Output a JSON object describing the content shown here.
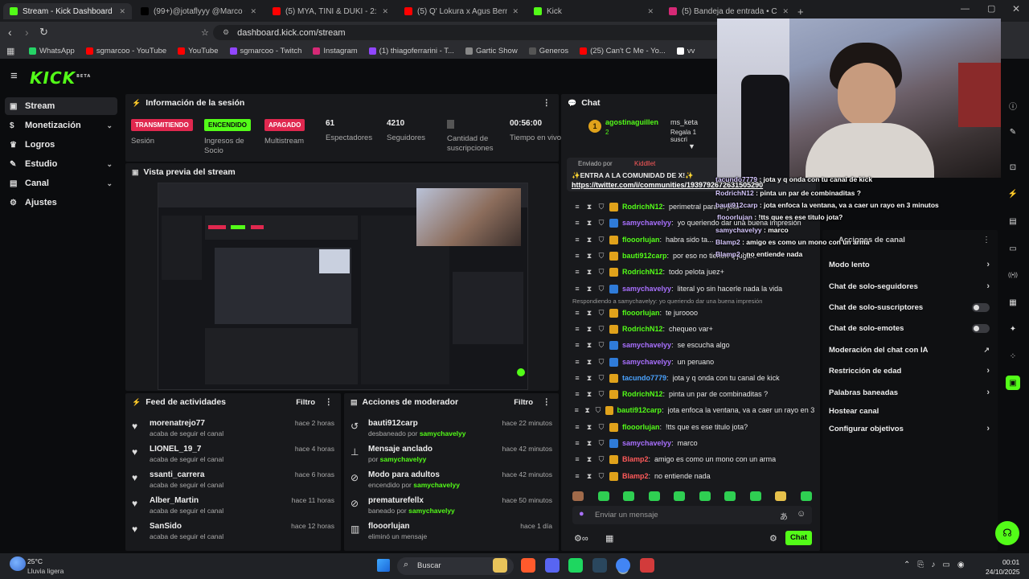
{
  "browser": {
    "tabs": [
      {
        "label": "Stream - Kick Dashboard",
        "color": "#53fc18"
      },
      {
        "label": "(99+)@jotaflyyy @Marco Guillén",
        "color": "#000000"
      },
      {
        "label": "(5) MYA, TINI & DUKI - 2:50 Remix (C",
        "color": "#ff0000"
      },
      {
        "label": "(5) Q' Lokura x Agus Bernasconi - CC",
        "color": "#ff0000"
      },
      {
        "label": "Kick",
        "color": "#53fc18"
      },
      {
        "label": "(5) Bandeja de entrada • Chats",
        "color": "#d62976"
      }
    ],
    "url": "dashboard.kick.com/stream",
    "bookmarks": [
      "WhatsApp",
      "sgmarcoo - YouTube",
      "YouTube",
      "sgmarcoo - Twitch",
      "Instagram",
      "(1) thiagoferrarini - T...",
      "Gartic Show",
      "Generos",
      "(25) Can't C Me - Yo...",
      "vv"
    ]
  },
  "kick": {
    "logo": "KICK",
    "beta": "BETA"
  },
  "sidebar": {
    "items": [
      {
        "label": "Stream",
        "icon": "video-icon"
      },
      {
        "label": "Monetización",
        "icon": "money-icon"
      },
      {
        "label": "Logros",
        "icon": "trophy-icon"
      },
      {
        "label": "Estudio",
        "icon": "studio-icon"
      },
      {
        "label": "Canal",
        "icon": "channel-icon"
      },
      {
        "label": "Ajustes",
        "icon": "gear-icon"
      }
    ]
  },
  "session": {
    "title": "Información de la sesión",
    "stats": [
      {
        "badge": "TRANSMITIENDO",
        "label": "Sesión"
      },
      {
        "badge": "ENCENDIDO",
        "label": "Ingresos de Socio"
      },
      {
        "badge": "APAGADO",
        "label": "Multistream"
      },
      {
        "value": "61",
        "label": "Espectadores"
      },
      {
        "value": "4210",
        "label": "Seguidores"
      },
      {
        "value": "",
        "label": "Cantidad de suscripciones"
      },
      {
        "value": "00:56:00",
        "label": "Tiempo en vivo"
      }
    ]
  },
  "preview": {
    "title": "Vista previa del stream"
  },
  "feed": {
    "title": "Feed de actividades",
    "filter": "Filtro",
    "items": [
      {
        "name": "morenatrejo77",
        "sub": "acaba de seguir el canal",
        "time": "hace 2 horas"
      },
      {
        "name": "LIONEL_19_7",
        "sub": "acaba de seguir el canal",
        "time": "hace 4 horas"
      },
      {
        "name": "ssanti_carrera",
        "sub": "acaba de seguir el canal",
        "time": "hace 6 horas"
      },
      {
        "name": "Alber_Martin",
        "sub": "acaba de seguir el canal",
        "time": "hace 11 horas"
      },
      {
        "name": "SanSido",
        "sub": "acaba de seguir el canal",
        "time": "hace 12 horas"
      }
    ]
  },
  "modactions": {
    "title": "Acciones de moderador",
    "filter": "Filtro",
    "items": [
      {
        "name": "bauti912carp",
        "sub": "desbaneado por",
        "by": "samychavelyy",
        "time": "hace 22 minutos"
      },
      {
        "name": "Mensaje anclado",
        "sub": "por",
        "by": "samychavelyy",
        "time": "hace 42 minutos"
      },
      {
        "name": "Modo para adultos",
        "sub": "encendido por",
        "by": "samychavelyy",
        "time": "hace 42 minutos"
      },
      {
        "name": "prematurefellx",
        "sub": "baneado por",
        "by": "samychavelyy",
        "time": "hace 50 minutos"
      },
      {
        "name": "flooorlujan",
        "sub": "eliminó un mensaje",
        "by": "",
        "time": "hace 1 día"
      }
    ]
  },
  "chat": {
    "title": "Chat",
    "gift": {
      "user": "agostinaguillen",
      "count": "2",
      "user2": "ms_keta",
      "text": "Regala 1 suscri"
    },
    "pinned": {
      "sent_by": "Enviado por",
      "sender": "Kiddllet",
      "text": "✨ENTRA A LA COMUNIDAD DE X!✨",
      "link": "https://twitter.com/i/communities/1939792672631505290"
    },
    "reply_note": "Respondiendo a samychavelyy: yo queriendo dar una buena impresión",
    "messages": [
      {
        "user": "RodrichN12",
        "color": "#53fc18",
        "text": "perimetral para el jota"
      },
      {
        "user": "samychavelyy",
        "color": "#a970ff",
        "text": "yo queriendo dar una buena impresión"
      },
      {
        "user": "flooorlujan",
        "color": "#53fc18",
        "text": "habra sido ta..."
      },
      {
        "user": "bauti912carp",
        "color": "#53fc18",
        "text": "por eso no tienen q juga..."
      },
      {
        "user": "RodrichN12",
        "color": "#53fc18",
        "text": "todo pelota juez+"
      },
      {
        "user": "samychavelyy",
        "color": "#a970ff",
        "text": "literal yo sin hacerle nada la vida"
      },
      {
        "user": "flooorlujan",
        "color": "#53fc18",
        "text": "te juroooo"
      },
      {
        "user": "RodrichN12",
        "color": "#53fc18",
        "text": "chequeo var+"
      },
      {
        "user": "samychavelyy",
        "color": "#a970ff",
        "text": "se escucha algo"
      },
      {
        "user": "samychavelyy",
        "color": "#a970ff",
        "text": "un peruano"
      },
      {
        "user": "tacundo7779",
        "color": "#4aa3ff",
        "text": "jota y q onda con tu canal de kick"
      },
      {
        "user": "RodrichN12",
        "color": "#53fc18",
        "text": "pinta un par de combinaditas ?"
      },
      {
        "user": "bauti912carp",
        "color": "#53fc18",
        "text": "jota enfoca la ventana, va a caer un rayo en 3 minutos"
      },
      {
        "user": "flooorlujan",
        "color": "#53fc18",
        "text": "!tts que es ese titulo jota?"
      },
      {
        "user": "samychavelyy",
        "color": "#a970ff",
        "text": "marco"
      },
      {
        "user": "Blamp2",
        "color": "#ff5a5a",
        "text": "amigo es como un mono con un arma"
      },
      {
        "user": "Blamp2",
        "color": "#ff5a5a",
        "text": "no entiende nada"
      }
    ],
    "input_placeholder": "Enviar un mensaje",
    "send": "Chat"
  },
  "overlay_chat": [
    {
      "user": "tacundo7779",
      "text": "jota y q onda con tu canal de kick"
    },
    {
      "user": "RodrichN12",
      "text": "pinta un par de combinaditas ?"
    },
    {
      "user": "bauti912carp",
      "text": "jota enfoca la ventana, va a caer un rayo en 3 minutos"
    },
    {
      "user": "flooorlujan",
      "text": "!tts que es ese titulo jota?"
    },
    {
      "user": "samychavelyy",
      "text": "marco"
    },
    {
      "user": "Blamp2",
      "text": "amigo es como un mono con un arma"
    },
    {
      "user": "Blamp2",
      "text": "no entiende nada"
    }
  ],
  "channel_actions": {
    "title": "Acciones de canal",
    "items": [
      {
        "label": "Modo lento",
        "kind": "chevron"
      },
      {
        "label": "Chat de solo-seguidores",
        "kind": "chevron"
      },
      {
        "label": "Chat de solo-suscriptores",
        "kind": "toggle"
      },
      {
        "label": "Chat de solo-emotes",
        "kind": "toggle"
      },
      {
        "label": "Moderación del chat con IA",
        "kind": "external"
      },
      {
        "label": "Restricción de edad",
        "kind": "chevron"
      },
      {
        "label": "Palabras baneadas",
        "kind": "chevron"
      },
      {
        "label": "Hostear canal",
        "kind": "none"
      },
      {
        "label": "Configurar objetivos",
        "kind": "chevron"
      }
    ]
  },
  "taskbar": {
    "weather_temp": "25°C",
    "weather_desc": "Lluvia ligera",
    "search": "Buscar",
    "time": "00:01",
    "date": "24/10/2025"
  }
}
